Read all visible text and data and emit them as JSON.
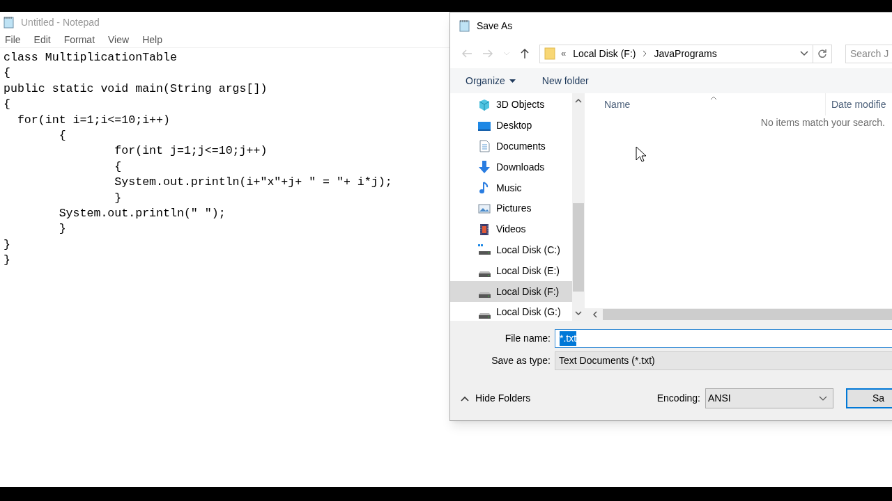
{
  "notepad": {
    "title": "Untitled - Notepad",
    "menu": [
      "File",
      "Edit",
      "Format",
      "View",
      "Help"
    ],
    "code": [
      "class MultiplicationTable",
      "{",
      "public static void main(String args[])",
      "{",
      "  for(int i=1;i<=10;i++)",
      "        {",
      "                for(int j=1;j<=10;j++)",
      "                {",
      "                System.out.println(i+\"x\"+j+ \" = \"+ i*j);",
      "                }",
      "        System.out.println(\" \");",
      "        }",
      "}",
      "}"
    ]
  },
  "dialog": {
    "title": "Save As",
    "address": {
      "overflow": "«",
      "crumbs": [
        "Local Disk (F:)",
        "JavaPrograms"
      ]
    },
    "search": {
      "placeholder": "Search J"
    },
    "toolbar": {
      "organize": "Organize",
      "new_folder": "New folder"
    },
    "nav_items": [
      {
        "label": "3D Objects",
        "kind": "objects3d",
        "selected": false
      },
      {
        "label": "Desktop",
        "kind": "desktop",
        "selected": false
      },
      {
        "label": "Documents",
        "kind": "documents",
        "selected": false
      },
      {
        "label": "Downloads",
        "kind": "downloads",
        "selected": false
      },
      {
        "label": "Music",
        "kind": "music",
        "selected": false
      },
      {
        "label": "Pictures",
        "kind": "pictures",
        "selected": false
      },
      {
        "label": "Videos",
        "kind": "videos",
        "selected": false
      },
      {
        "label": "Local Disk (C:)",
        "kind": "systemdisk",
        "selected": false
      },
      {
        "label": "Local Disk (E:)",
        "kind": "disk",
        "selected": false
      },
      {
        "label": "Local Disk (F:)",
        "kind": "disk",
        "selected": true
      },
      {
        "label": "Local Disk (G:)",
        "kind": "disk",
        "selected": false
      }
    ],
    "columns": [
      "Name",
      "Date modifie"
    ],
    "empty_message": "No items match your search.",
    "file_name": {
      "label": "File name:",
      "value": "*.txt",
      "text_selected": true
    },
    "save_as_type": {
      "label": "Save as type:",
      "value": "Text Documents (*.txt)"
    },
    "hide_folders": "Hide Folders",
    "encoding": {
      "label": "Encoding:",
      "value": "ANSI"
    },
    "save_button": "Sa"
  }
}
